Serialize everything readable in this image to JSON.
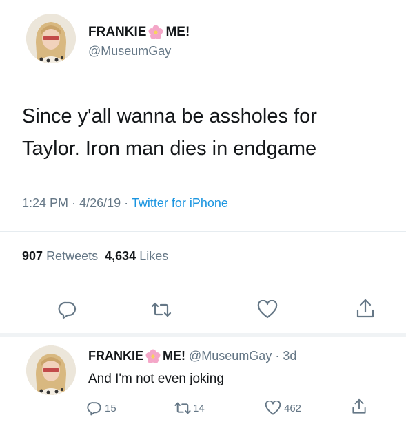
{
  "main_tweet": {
    "display_name_pre": "FRANKIE",
    "display_name_post": "ME!",
    "handle": "@MuseumGay",
    "text_line1": "Since y'all wanna be assholes for",
    "text_line2": "Taylor. Iron man dies in endgame",
    "time": "1:24 PM",
    "date": "4/26/19",
    "source": "Twitter for iPhone",
    "retweets_count": "907",
    "retweets_label": "Retweets",
    "likes_count": "4,634",
    "likes_label": "Likes"
  },
  "reply_tweet": {
    "display_name_pre": "FRANKIE",
    "display_name_post": "ME!",
    "handle": "@MuseumGay",
    "age": "3d",
    "text": "And I'm not even joking",
    "reply_count": "15",
    "retweet_count": "14",
    "like_count": "462"
  },
  "icons": [
    "avatar",
    "flower-emoji",
    "reply-icon",
    "retweet-icon",
    "like-icon",
    "share-icon"
  ],
  "colors": {
    "link": "#1b95e0",
    "meta_grey": "#657786",
    "divider": "#e6ecf0",
    "flower": "#f4a7c8"
  }
}
